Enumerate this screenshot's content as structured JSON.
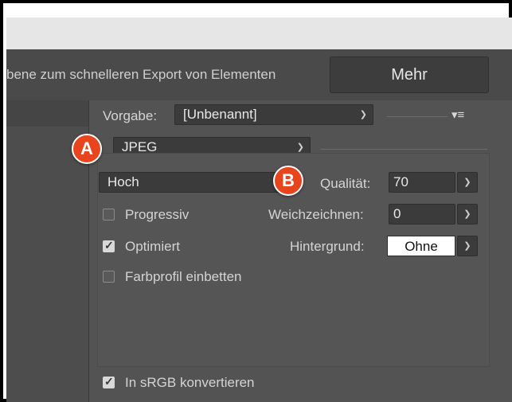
{
  "window": {
    "hint_text": "bene zum schnelleren Export von Elementen",
    "more_button": "Mehr"
  },
  "preset": {
    "label": "Vorgabe:",
    "value": "[Unbenannt]"
  },
  "format": {
    "value": "JPEG"
  },
  "quality": {
    "preset_value": "Hoch",
    "label": "Qualität:",
    "value": "70"
  },
  "blur": {
    "label": "Weichzeichnen:",
    "value": "0"
  },
  "matte": {
    "label": "Hintergrund:",
    "value": "Ohne"
  },
  "options": [
    {
      "label": "Progressiv",
      "checked": false
    },
    {
      "label": "Optimiert",
      "checked": true
    },
    {
      "label": "Farbprofil einbetten",
      "checked": false
    }
  ],
  "srgb": {
    "label": "In sRGB konvertieren",
    "checked": true
  },
  "annotations": {
    "a": "A",
    "b": "B"
  },
  "icons": {
    "menu": "panel-menu-icon",
    "chevron": "chevron-down-icon",
    "check": "checkmark-icon"
  },
  "colors": {
    "badge": "#e8451e",
    "panel": "#535353"
  }
}
